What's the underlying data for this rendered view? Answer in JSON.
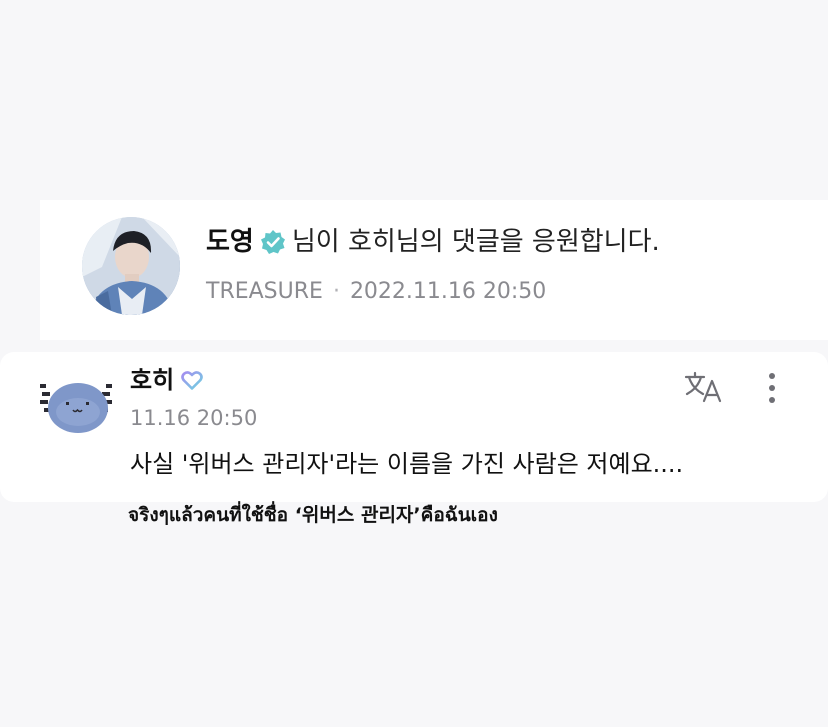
{
  "notification": {
    "user_name": "도영",
    "message": "님이 호히님의 댓글을 응원합니다.",
    "group": "TREASURE",
    "separator": "·",
    "timestamp": "2022.11.16 20:50",
    "avatar_icon": "profile-photo",
    "badge_icon": "verified-check-icon",
    "badge_color": "#5fc5c8"
  },
  "comment": {
    "author": "호히",
    "author_badge_icon": "heart-icon",
    "time": "11.16 20:50",
    "text": "사실 '위버스 관리자'라는 이름을 가진 사람은 저예요....",
    "translate_icon": "translate-icon",
    "more_icon": "more-vertical-icon",
    "avatar_icon": "axolotl-avatar",
    "avatar_color": "#7f97c9"
  },
  "caption": {
    "text": "จริงๆแล้วคนที่ใช้ชื่อ ‘위버스 관리자’คือฉันเอง"
  }
}
